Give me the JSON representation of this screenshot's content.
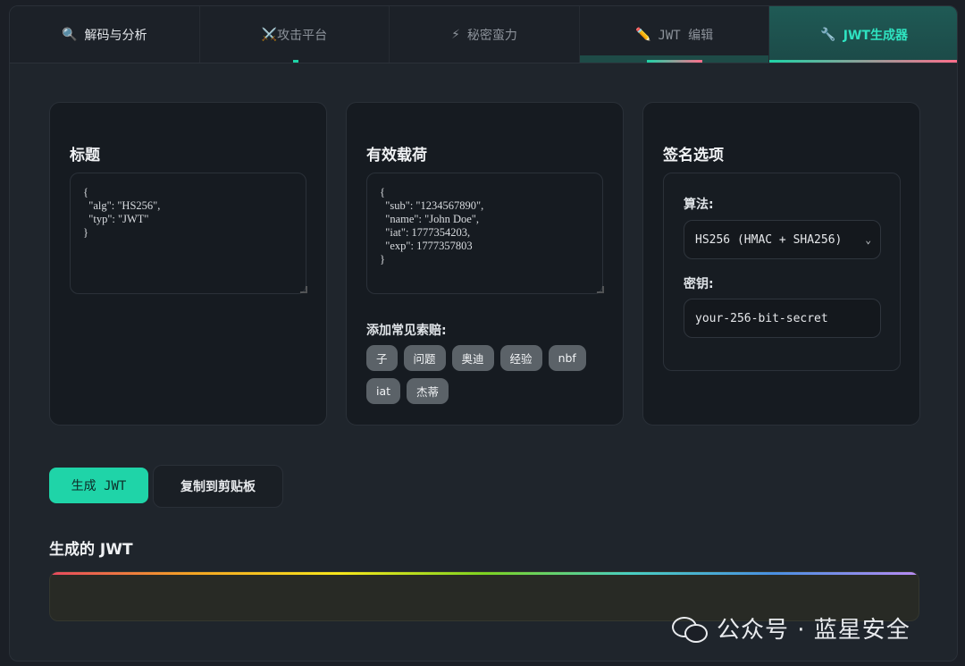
{
  "tabs": [
    {
      "icon": "🔍",
      "label": "解码与分析"
    },
    {
      "icon": "⚔️",
      "label": "攻击平台"
    },
    {
      "icon": "⚡",
      "label": "秘密蛮力"
    },
    {
      "icon": "✏️",
      "label": "JWT 编辑"
    },
    {
      "icon": "🔧",
      "label": "JWT生成器"
    }
  ],
  "active_tab": "JWT生成器",
  "header_card": {
    "title": "标题",
    "content": "{\n  \"alg\": \"HS256\",\n  \"typ\": \"JWT\"\n}"
  },
  "payload_card": {
    "title": "有效载荷",
    "content": "{\n  \"sub\": \"1234567890\",\n  \"name\": \"John Doe\",\n  \"iat\": 1777354203,\n  \"exp\": 1777357803\n}",
    "claims_label": "添加常见索赔:",
    "claims": [
      "子",
      "问题",
      "奥迪",
      "经验",
      "nbf",
      "iat",
      "杰蒂"
    ]
  },
  "signature_card": {
    "title": "签名选项",
    "algorithm_label": "算法:",
    "algorithm_value": "HS256 (HMAC + SHA256)",
    "secret_label": "密钥:",
    "secret_value": "your-256-bit-secret"
  },
  "actions": {
    "generate": "生成 JWT",
    "copy": "复制到剪贴板"
  },
  "output": {
    "title": "生成的 JWT",
    "value": ""
  },
  "watermark": "公众号 · 蓝星安全",
  "colors": {
    "accent": "#1fd4a8",
    "active_tab_text": "#2fe3c1",
    "background": "#1f252c",
    "card": "#161b21",
    "chip": "#5b6268"
  }
}
